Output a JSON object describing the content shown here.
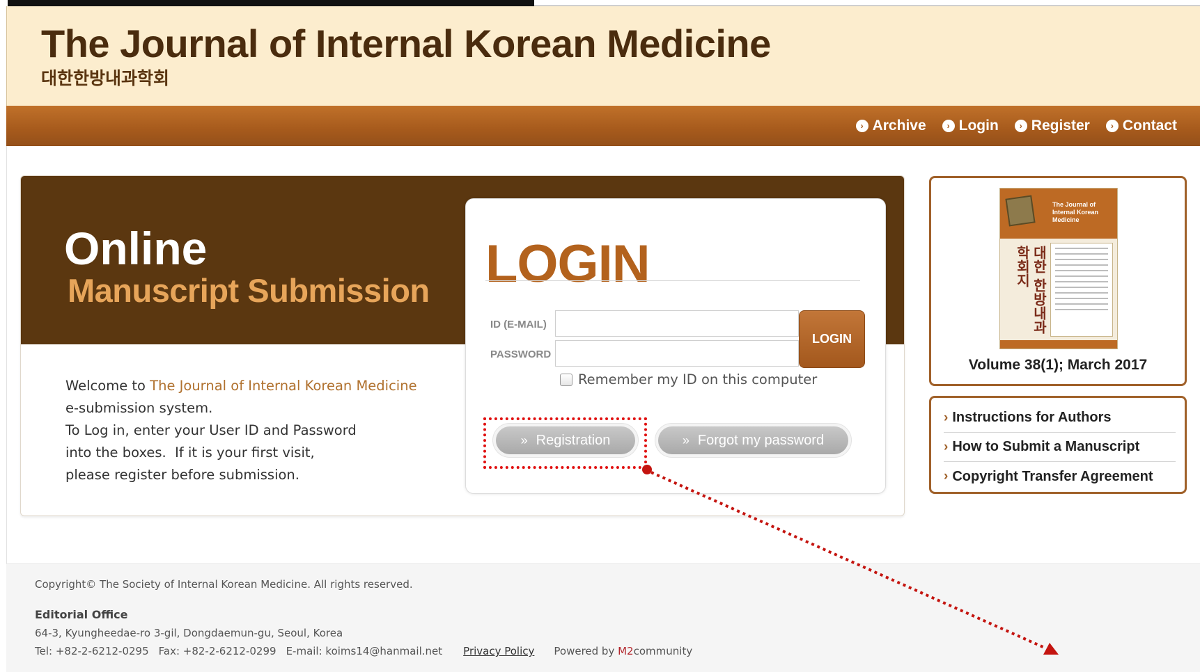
{
  "header": {
    "title": "The Journal of Internal Korean Medicine",
    "subtitle": "대한한방내과학회"
  },
  "nav": {
    "archive": "Archive",
    "login": "Login",
    "register": "Register",
    "contact": "Contact"
  },
  "hero": {
    "title": "Online",
    "subtitle": "Manuscript Submission"
  },
  "welcome": {
    "prefix": "Welcome to ",
    "journal_name": "The Journal of Internal Korean Medicine",
    "line1_end": "e-submission system.",
    "line2": "To Log in, enter your User ID and Password",
    "line3": "into the boxes.  If it is your first visit,",
    "line4": "please register before submission."
  },
  "login": {
    "heading": "LOGIN",
    "id_label": "ID (E-MAIL)",
    "id_value": "",
    "password_label": "PASSWORD",
    "password_value": "",
    "button": "LOGIN",
    "remember": "Remember my ID on this computer",
    "remember_checked": false,
    "registration": "Registration",
    "forgot": "Forgot my password"
  },
  "issue": {
    "cover_journal": "The Journal of Internal Korean Medicine",
    "cover_korean": "대한 한방내과 학회지",
    "volume": "Volume 38(1); March 2017"
  },
  "links": [
    "Instructions for Authors",
    "How to Submit a Manuscript",
    "Copyright Transfer Agreement"
  ],
  "footer": {
    "copyright": "Copyright© The Society of Internal Korean Medicine. All rights reserved.",
    "office_title": "Editorial Office",
    "address": "64-3, Kyungheedae-ro 3-gil, Dongdaemun-gu, Seoul, Korea",
    "tel": "Tel: +82-2-6212-0295",
    "fax": "Fax: +82-2-6212-0299",
    "email": "E-mail: koims14@hanmail.net",
    "privacy": "Privacy Policy",
    "powered_prefix": "Powered by ",
    "powered_m2": "M2",
    "powered_rest": "community"
  },
  "colors": {
    "brand_brown": "#5b3710",
    "nav_orange": "#a65a1c",
    "accent": "#b3621d",
    "annotation_red": "#e01010"
  }
}
